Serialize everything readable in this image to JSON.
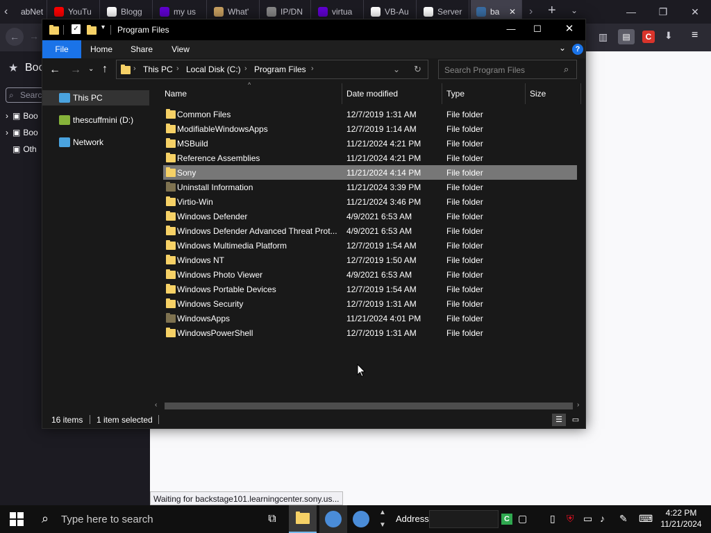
{
  "browser": {
    "tabs": [
      {
        "label": "abNet",
        "fav": "#3a3944"
      },
      {
        "label": "YouTu",
        "fav": "#ff0000"
      },
      {
        "label": "Blogg",
        "fav": "#ffffff"
      },
      {
        "label": "my us",
        "fav": "#6001d2"
      },
      {
        "label": "What'",
        "fav": "#c8a060"
      },
      {
        "label": "IP/DN",
        "fav": "#888888"
      },
      {
        "label": "virtua",
        "fav": "#6001d2"
      },
      {
        "label": "VB-Au",
        "fav": "#ffffff"
      },
      {
        "label": "Server",
        "fav": "#ffffff"
      },
      {
        "label": "ba",
        "fav": "#3a6ea5"
      }
    ],
    "sidebar": {
      "title": "Boo",
      "search_placeholder": "Search",
      "items": [
        "Boo",
        "Boo",
        "Oth"
      ]
    },
    "status_text": "Waiting for backstage101.learningcenter.sony.us..."
  },
  "explorer": {
    "title": "Program Files",
    "ribbon_tabs": [
      "File",
      "Home",
      "Share",
      "View"
    ],
    "breadcrumb": [
      "This PC",
      "Local Disk (C:)",
      "Program Files"
    ],
    "search_placeholder": "Search Program Files",
    "nav": [
      {
        "label": "This PC",
        "icon": "computer-icon",
        "selected": true
      },
      {
        "label": "thescuffmini (D:)",
        "icon": "drive-icon",
        "selected": false
      },
      {
        "label": "Network",
        "icon": "network-icon",
        "selected": false
      }
    ],
    "columns": [
      "Name",
      "Date modified",
      "Type",
      "Size"
    ],
    "files": [
      {
        "name": "Common Files",
        "date": "12/7/2019 1:31 AM",
        "type": "File folder",
        "dim": false,
        "selected": false
      },
      {
        "name": "ModifiableWindowsApps",
        "date": "12/7/2019 1:14 AM",
        "type": "File folder",
        "dim": false,
        "selected": false
      },
      {
        "name": "MSBuild",
        "date": "11/21/2024 4:21 PM",
        "type": "File folder",
        "dim": false,
        "selected": false
      },
      {
        "name": "Reference Assemblies",
        "date": "11/21/2024 4:21 PM",
        "type": "File folder",
        "dim": false,
        "selected": false
      },
      {
        "name": "Sony",
        "date": "11/21/2024 4:14 PM",
        "type": "File folder",
        "dim": false,
        "selected": true
      },
      {
        "name": "Uninstall Information",
        "date": "11/21/2024 3:39 PM",
        "type": "File folder",
        "dim": true,
        "selected": false
      },
      {
        "name": "Virtio-Win",
        "date": "11/21/2024 3:46 PM",
        "type": "File folder",
        "dim": false,
        "selected": false
      },
      {
        "name": "Windows Defender",
        "date": "4/9/2021 6:53 AM",
        "type": "File folder",
        "dim": false,
        "selected": false
      },
      {
        "name": "Windows Defender Advanced Threat Prot...",
        "date": "4/9/2021 6:53 AM",
        "type": "File folder",
        "dim": false,
        "selected": false
      },
      {
        "name": "Windows Multimedia Platform",
        "date": "12/7/2019 1:54 AM",
        "type": "File folder",
        "dim": false,
        "selected": false
      },
      {
        "name": "Windows NT",
        "date": "12/7/2019 1:50 AM",
        "type": "File folder",
        "dim": false,
        "selected": false
      },
      {
        "name": "Windows Photo Viewer",
        "date": "4/9/2021 6:53 AM",
        "type": "File folder",
        "dim": false,
        "selected": false
      },
      {
        "name": "Windows Portable Devices",
        "date": "12/7/2019 1:54 AM",
        "type": "File folder",
        "dim": false,
        "selected": false
      },
      {
        "name": "Windows Security",
        "date": "12/7/2019 1:31 AM",
        "type": "File folder",
        "dim": false,
        "selected": false
      },
      {
        "name": "WindowsApps",
        "date": "11/21/2024 4:01 PM",
        "type": "File folder",
        "dim": true,
        "selected": false
      },
      {
        "name": "WindowsPowerShell",
        "date": "12/7/2019 1:31 AM",
        "type": "File folder",
        "dim": false,
        "selected": false
      }
    ],
    "status": {
      "count": "16 items",
      "selection": "1 item selected"
    }
  },
  "taskbar": {
    "search_placeholder": "Type here to search",
    "address_label": "Address",
    "time": "4:22 PM",
    "date": "11/21/2024"
  },
  "colors": {
    "accent": "#0078d7",
    "folder": "#f6d166",
    "selection": "#777777"
  }
}
